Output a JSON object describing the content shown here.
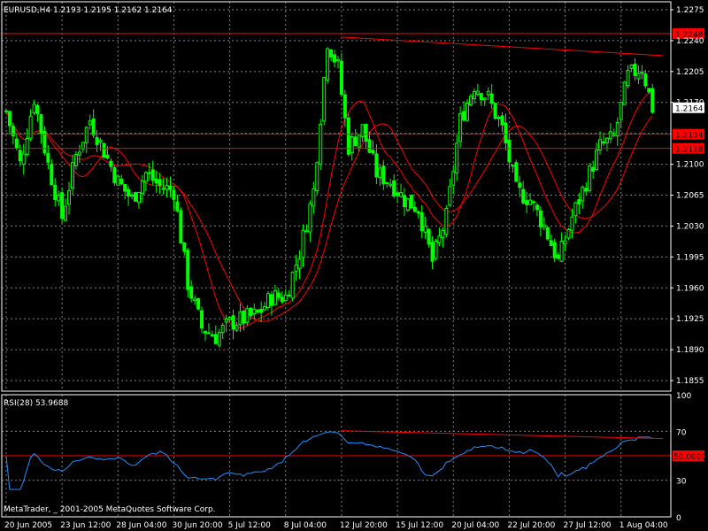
{
  "colors": {
    "background": "#000000",
    "grid": "#7f7f7f",
    "frame": "#ffffff",
    "text": "#ffffff",
    "bull": "#00ff00",
    "ma": "#ff0000",
    "level": "#ff0000",
    "rsi": "#1e90ff"
  },
  "chart_data": [
    {
      "type": "candlestick",
      "title": "EURUSD,H4  1.2193 1.2195 1.2162 1.2164",
      "ylim": [
        1.1843,
        1.2284
      ],
      "y_ticks": [
        "1.2275",
        "1.2240",
        "1.2205",
        "1.2170",
        "1.2135",
        "1.2100",
        "1.2065",
        "1.2030",
        "1.1995",
        "1.1960",
        "1.1925",
        "1.1890",
        "1.1855"
      ],
      "y_tick_values": [
        1.2275,
        1.224,
        1.2205,
        1.217,
        1.2135,
        1.21,
        1.2065,
        1.203,
        1.1995,
        1.196,
        1.1925,
        1.189,
        1.1855
      ],
      "x_ticks": [
        "20 Jun 2005",
        "23 Jun 12:00",
        "28 Jun 04:00",
        "30 Jun 20:00",
        "5 Jul 12:00",
        "8 Jul 04:00",
        "12 Jul 20:00",
        "15 Jul 12:00",
        "20 Jul 04:00",
        "22 Jul 20:00",
        "27 Jul 12:00",
        "1 Aug 04:00"
      ],
      "x_tick_index": [
        0,
        16,
        32,
        48,
        64,
        80,
        96,
        112,
        128,
        144,
        160,
        176
      ],
      "close_anchors": [
        [
          0,
          1.216
        ],
        [
          4,
          1.21
        ],
        [
          8,
          1.2175
        ],
        [
          12,
          1.21
        ],
        [
          16,
          1.204
        ],
        [
          20,
          1.211
        ],
        [
          24,
          1.215
        ],
        [
          28,
          1.2115
        ],
        [
          32,
          1.208
        ],
        [
          36,
          1.206
        ],
        [
          40,
          1.209
        ],
        [
          44,
          1.2075
        ],
        [
          48,
          1.207
        ],
        [
          52,
          1.1965
        ],
        [
          56,
          1.1915
        ],
        [
          60,
          1.1905
        ],
        [
          64,
          1.192
        ],
        [
          68,
          1.1925
        ],
        [
          72,
          1.193
        ],
        [
          76,
          1.195
        ],
        [
          80,
          1.195
        ],
        [
          84,
          1.2
        ],
        [
          88,
          1.207
        ],
        [
          92,
          1.224
        ],
        [
          95,
          1.221
        ],
        [
          98,
          1.212
        ],
        [
          102,
          1.214
        ],
        [
          106,
          1.209
        ],
        [
          110,
          1.208
        ],
        [
          114,
          1.206
        ],
        [
          118,
          1.205
        ],
        [
          122,
          1.199
        ],
        [
          126,
          1.204
        ],
        [
          130,
          1.215
        ],
        [
          134,
          1.219
        ],
        [
          138,
          1.2175
        ],
        [
          142,
          1.214
        ],
        [
          146,
          1.207
        ],
        [
          150,
          1.206
        ],
        [
          154,
          1.203
        ],
        [
          158,
          1.199
        ],
        [
          162,
          1.204
        ],
        [
          166,
          1.208
        ],
        [
          170,
          1.212
        ],
        [
          174,
          1.213
        ],
        [
          178,
          1.22
        ],
        [
          182,
          1.221
        ],
        [
          185,
          1.2164
        ]
      ],
      "moving_averages": [
        {
          "period": 12
        },
        {
          "period": 20
        }
      ],
      "horizontal_levels": [
        {
          "label": "1.2248",
          "value": 1.2248
        },
        {
          "label": "1.2134",
          "value": 1.2134
        },
        {
          "label": "1.2118",
          "value": 1.2118
        }
      ],
      "current_price": {
        "label": "1.2164",
        "value": 1.2164
      },
      "trendline": {
        "from_index": 96,
        "from_value": 1.2244,
        "to_index": 188,
        "to_value": 1.2223
      }
    },
    {
      "type": "line",
      "title": "RSI(28) 53.9688",
      "ylim": [
        0,
        100
      ],
      "y_ticks": [
        "100",
        "70",
        "30",
        "0"
      ],
      "y_tick_values": [
        100,
        70,
        30,
        0
      ],
      "levels": [
        {
          "label": "50.0000",
          "value": 50
        },
        {
          "value": 70
        }
      ],
      "trendline": {
        "from_index": 96,
        "from_value": 70.5,
        "to_index": 188,
        "to_value": 64
      }
    }
  ],
  "footer": {
    "copyright": "MetaTrader, _ 2001-2005 MetaQuotes Software Corp."
  }
}
